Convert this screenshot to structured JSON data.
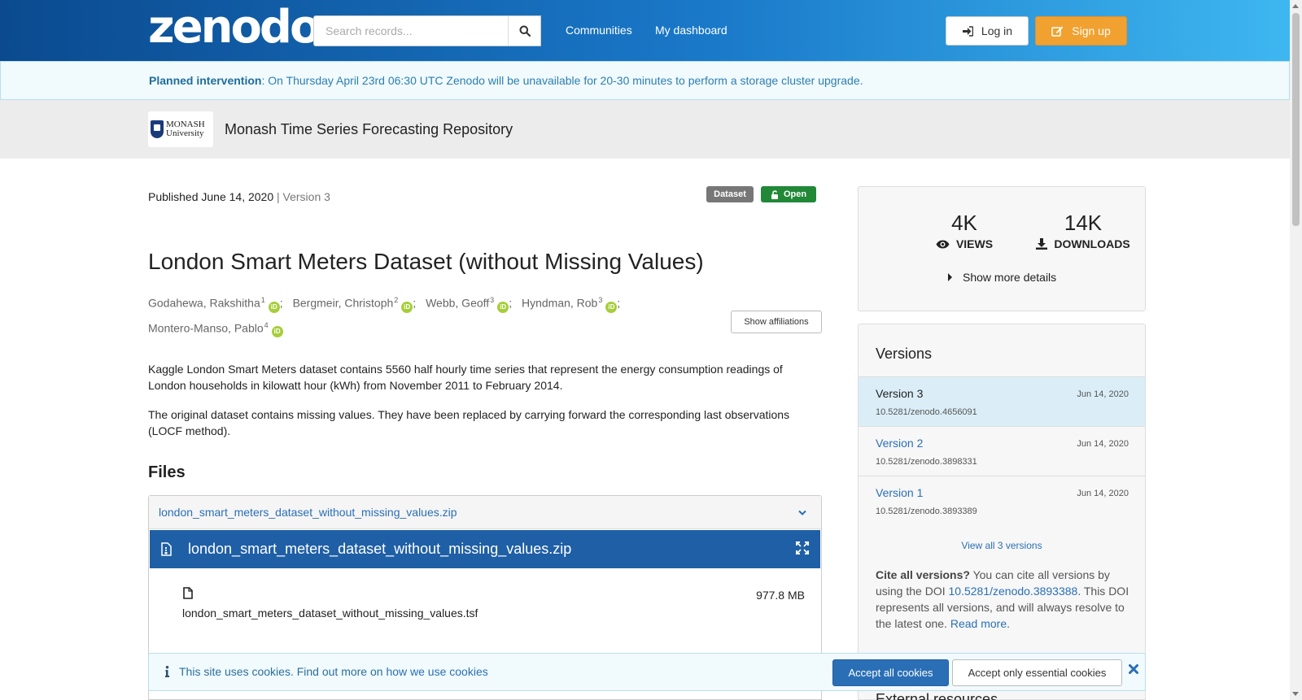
{
  "header": {
    "logo_text": "zenodo",
    "search_placeholder": "Search records...",
    "nav": [
      "Communities",
      "My dashboard"
    ],
    "login_label": "Log in",
    "signup_label": "Sign up"
  },
  "banner": {
    "bold": "Planned intervention",
    "text": ": On Thursday April 23rd 06:30 UTC Zenodo will be unavailable for 20-30 minutes to perform a storage cluster upgrade."
  },
  "community": {
    "logo_line1": "MONASH",
    "logo_line2": "University",
    "title": "Monash Time Series Forecasting Repository"
  },
  "record": {
    "published": "Published June 14, 2020",
    "version_sep": " | ",
    "version": "Version 3",
    "badge_type": "Dataset",
    "badge_access": "Open",
    "title": "London Smart Meters Dataset (without Missing Values)",
    "creators": [
      {
        "name": "Godahewa, Rakshitha",
        "aff": "1"
      },
      {
        "name": "Bergmeir, Christoph",
        "aff": "2"
      },
      {
        "name": "Webb, Geoff",
        "aff": "3"
      },
      {
        "name": "Hyndman, Rob",
        "aff": "3"
      },
      {
        "name": "Montero-Manso, Pablo",
        "aff": "4"
      }
    ],
    "orcid_label": "iD",
    "show_affiliations": "Show affiliations",
    "description": [
      "Kaggle London Smart Meters dataset contains 5560 half hourly time series that represent the energy consumption readings of London households in kilowatt hour (kWh) from November 2011 to February 2014.",
      "The original dataset contains missing values. They have been replaced by carrying forward the corresponding last observations (LOCF method)."
    ]
  },
  "files": {
    "title": "Files",
    "archive_name": "london_smart_meters_dataset_without_missing_values.zip",
    "preview_title": "london_smart_meters_dataset_without_missing_values.zip",
    "entries": [
      {
        "name": "london_smart_meters_dataset_without_missing_values.tsf",
        "size": "977.8 MB"
      }
    ]
  },
  "stats": {
    "views_num": "4K",
    "views_label": "VIEWS",
    "downloads_num": "14K",
    "downloads_label": "DOWNLOADS",
    "more_details": "Show more details"
  },
  "versions": {
    "title": "Versions",
    "items": [
      {
        "name": "Version 3",
        "date": "Jun 14, 2020",
        "doi": "10.5281/zenodo.4656091",
        "active": true
      },
      {
        "name": "Version 2",
        "date": "Jun 14, 2020",
        "doi": "10.5281/zenodo.3898331",
        "active": false
      },
      {
        "name": "Version 1",
        "date": "Jun 14, 2020",
        "doi": "10.5281/zenodo.3893389",
        "active": false
      }
    ],
    "view_all": "View all 3 versions",
    "cite_bold": "Cite all versions?",
    "cite_text1": " You can cite all versions by using the DOI ",
    "cite_doi": "10.5281/zenodo.3893388",
    "cite_text2": ". This DOI represents all versions, and will always resolve to the latest one. ",
    "read_more": "Read more",
    "cite_end": ".",
    "external_resources": "External resources"
  },
  "cookies": {
    "text": "This site uses cookies. Find out more on ",
    "link": "how we use cookies",
    "accept_all": "Accept all cookies",
    "accept_essential": "Accept only essential cookies"
  },
  "colors": {
    "primary": "#2a6fb6",
    "signup": "#f0a12f",
    "open_badge": "#218838",
    "orcid": "#a6ce39"
  }
}
